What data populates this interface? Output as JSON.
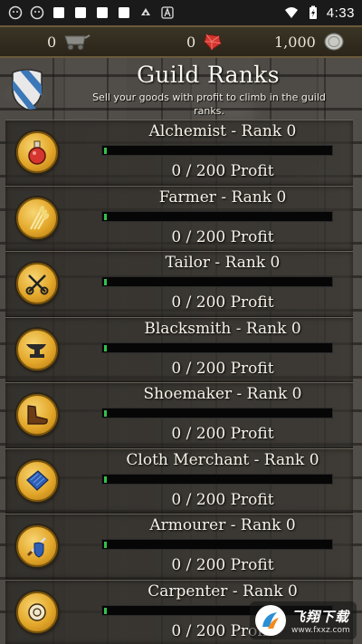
{
  "status_bar": {
    "time": "4:33",
    "left_icons": [
      "face-icon",
      "face-icon",
      "square-icon",
      "square-icon",
      "square-icon",
      "square-icon",
      "android-head-icon",
      "letter-a-icon"
    ],
    "right_icons": [
      "wifi-icon",
      "battery-charging-icon"
    ]
  },
  "currency": {
    "carts": "0",
    "gems": "0",
    "coins": "1,000"
  },
  "header": {
    "title": "Guild Ranks",
    "subtitle": "Sell your goods with profit to climb in the guild ranks."
  },
  "ranks": [
    {
      "name": "Alchemist - Rank 0",
      "profit": "0 / 200 Profit",
      "progress": 0,
      "icon": "potion-icon"
    },
    {
      "name": "Farmer - Rank 0",
      "profit": "0 / 200 Profit",
      "progress": 0,
      "icon": "wheat-icon"
    },
    {
      "name": "Tailor - Rank 0",
      "profit": "0 / 200 Profit",
      "progress": 0,
      "icon": "scissors-icon"
    },
    {
      "name": "Blacksmith - Rank 0",
      "profit": "0 / 200 Profit",
      "progress": 0,
      "icon": "anvil-icon"
    },
    {
      "name": "Shoemaker - Rank 0",
      "profit": "0 / 200 Profit",
      "progress": 0,
      "icon": "boot-icon"
    },
    {
      "name": "Cloth Merchant - Rank 0",
      "profit": "0 / 200 Profit",
      "progress": 0,
      "icon": "cloth-icon"
    },
    {
      "name": "Armourer - Rank 0",
      "profit": "0 / 200 Profit",
      "progress": 0,
      "icon": "shield-sword-icon"
    },
    {
      "name": "Carpenter - Rank 0",
      "profit": "0 / 200 Profit",
      "progress": 0,
      "icon": "saw-icon"
    }
  ],
  "watermark": {
    "text": "飞翔下载",
    "url": "www.fxxz.com"
  },
  "colors": {
    "progress_fill": "#33c24a",
    "badge_gold": "#e3a72a",
    "stone": "#4a4743"
  }
}
